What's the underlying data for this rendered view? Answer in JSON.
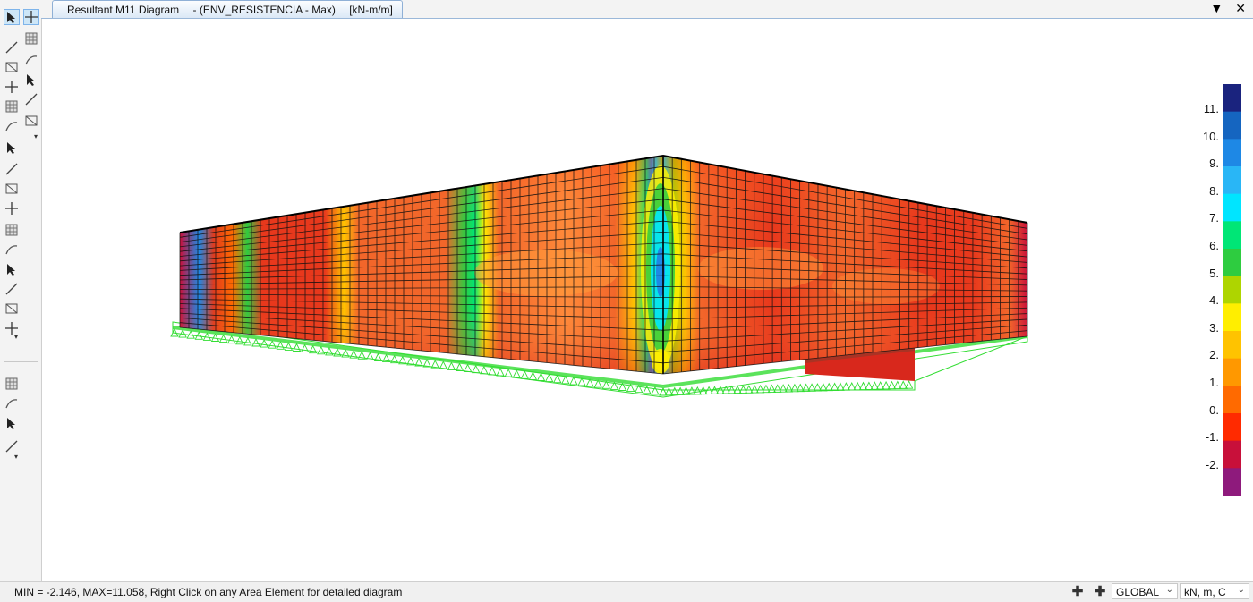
{
  "window": {
    "tab_title": "Resultant M11 Diagram",
    "tab_case": "- (ENV_RESISTENCIA - Max)",
    "tab_units": "[kN-m/m]",
    "dropdown_icon": "chevron-down-icon",
    "close_icon": "close-icon",
    "dropdown_glyph": "▼",
    "close_glyph": "✕"
  },
  "toolbar": {
    "tools": [
      "pointer-icon",
      "select-move-icon",
      "pencil-draw-icon",
      "zoom-window-icon",
      "frame-section-icon",
      "intersect-icon",
      "line-draw-icon",
      "pan-move-icon",
      "area-draw-icon",
      "trim-extend-icon",
      "area-grid-icon",
      "mesh-icon",
      "replicate-icon",
      "shell-icon",
      "slab-icon",
      "wall-icon",
      "grid-select-icon",
      "link-icon",
      "spring-icon",
      "section-cut-icon",
      "join-icon",
      "wall-stack-icon",
      "support-icon",
      "restraint-icon",
      "fixed-support-icon",
      "pin-support-icon",
      "section-designer-icon"
    ]
  },
  "legend": {
    "labels": [
      "11.",
      "10.",
      "9.",
      "8.",
      "7.",
      "6.",
      "5.",
      "4.",
      "3.",
      "2.",
      "1.",
      "0.",
      "-1.",
      "-2."
    ],
    "colors": [
      "#1a237e",
      "#1565c0",
      "#1e88e5",
      "#29b6f6",
      "#00e5ff",
      "#00e676",
      "#2ecc40",
      "#aed500",
      "#ffee00",
      "#ffc300",
      "#ff9800",
      "#ff6a00",
      "#ff2a00",
      "#c8103a",
      "#8e1a7c"
    ]
  },
  "diagram": {
    "colors": {
      "hot": "#e8381c",
      "warm": "#f2662a",
      "mid": "#ffb347",
      "cool": "#00e676",
      "cold": "#1e88e5",
      "mesh": "#111111",
      "support": "#33dd33"
    }
  },
  "status": {
    "message": "MIN = -2.146, MAX=11.058, Right Click on any Area Element for detailed diagram",
    "coord_system": "GLOBAL",
    "units": "kN, m, C",
    "add_glyph": "✚"
  }
}
